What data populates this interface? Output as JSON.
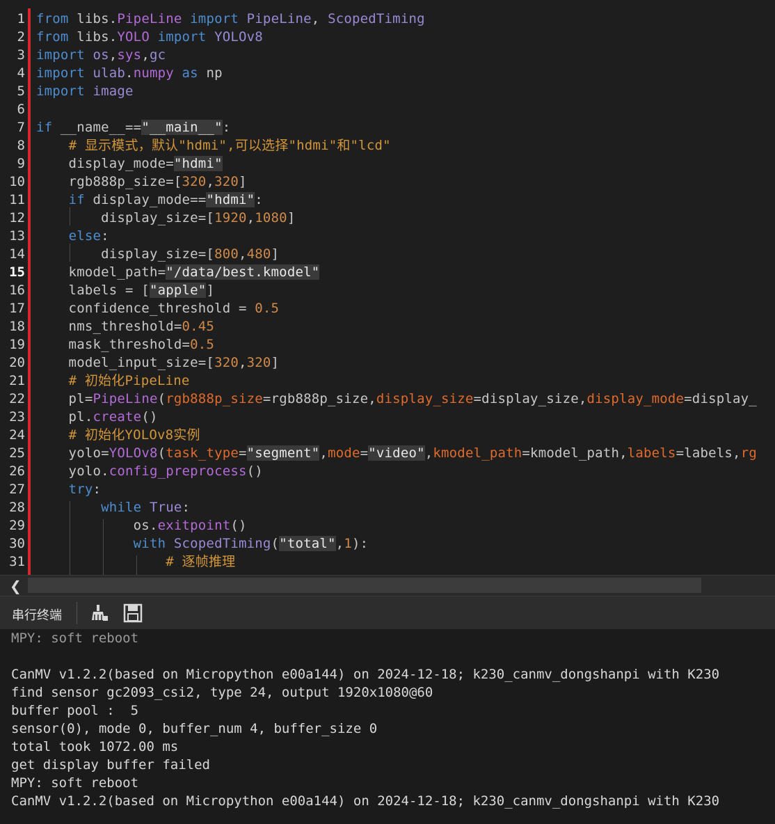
{
  "editor": {
    "current_line": 15,
    "lines": [
      {
        "n": "1",
        "tokens": [
          [
            "kw",
            "from "
          ],
          [
            "mod",
            "libs"
          ],
          [
            "plain",
            "."
          ],
          [
            "fn",
            "PipeLine"
          ],
          [
            "kw",
            " import "
          ],
          [
            "cls",
            "PipeLine"
          ],
          [
            "plain",
            ", "
          ],
          [
            "cls",
            "ScopedTiming"
          ]
        ]
      },
      {
        "n": "2",
        "tokens": [
          [
            "kw",
            "from "
          ],
          [
            "mod",
            "libs"
          ],
          [
            "plain",
            "."
          ],
          [
            "fn",
            "YOLO"
          ],
          [
            "kw",
            " import "
          ],
          [
            "cls",
            "YOLOv8"
          ]
        ]
      },
      {
        "n": "3",
        "tokens": [
          [
            "kw",
            "import "
          ],
          [
            "cls",
            "os"
          ],
          [
            "plain",
            ","
          ],
          [
            "fn",
            "sys"
          ],
          [
            "plain",
            ","
          ],
          [
            "cls",
            "gc"
          ]
        ]
      },
      {
        "n": "4",
        "tokens": [
          [
            "kw",
            "import "
          ],
          [
            "cls",
            "ulab"
          ],
          [
            "plain",
            "."
          ],
          [
            "fn",
            "numpy"
          ],
          [
            "kw",
            " as "
          ],
          [
            "plain",
            "np"
          ]
        ]
      },
      {
        "n": "5",
        "tokens": [
          [
            "kw",
            "import "
          ],
          [
            "cls",
            "image"
          ]
        ]
      },
      {
        "n": "6",
        "tokens": []
      },
      {
        "n": "7",
        "tokens": [
          [
            "kw",
            "if "
          ],
          [
            "plain",
            "__name__=="
          ],
          [
            "str",
            "\"__main__\""
          ],
          [
            "plain",
            ":"
          ]
        ]
      },
      {
        "n": "8",
        "tokens": [
          [
            "plain",
            "    "
          ],
          [
            "cmt",
            "# 显示模式，默认\"hdmi\",可以选择\"hdmi\"和\"lcd\""
          ]
        ]
      },
      {
        "n": "9",
        "tokens": [
          [
            "plain",
            "    display_mode="
          ],
          [
            "str",
            "\"hdmi\""
          ]
        ]
      },
      {
        "n": "10",
        "tokens": [
          [
            "plain",
            "    rgb888p_size=["
          ],
          [
            "num",
            "320"
          ],
          [
            "plain",
            ","
          ],
          [
            "num",
            "320"
          ],
          [
            "plain",
            "]"
          ]
        ]
      },
      {
        "n": "11",
        "tokens": [
          [
            "plain",
            "    "
          ],
          [
            "kw",
            "if "
          ],
          [
            "plain",
            "display_mode=="
          ],
          [
            "str",
            "\"hdmi\""
          ],
          [
            "plain",
            ":"
          ]
        ]
      },
      {
        "n": "12",
        "tokens": [
          [
            "plain",
            "        display_size=["
          ],
          [
            "num",
            "1920"
          ],
          [
            "plain",
            ","
          ],
          [
            "num",
            "1080"
          ],
          [
            "plain",
            "]"
          ]
        ]
      },
      {
        "n": "13",
        "tokens": [
          [
            "plain",
            "    "
          ],
          [
            "kw",
            "else"
          ],
          [
            "plain",
            ":"
          ]
        ]
      },
      {
        "n": "14",
        "tokens": [
          [
            "plain",
            "        display_size=["
          ],
          [
            "num",
            "800"
          ],
          [
            "plain",
            ","
          ],
          [
            "num",
            "480"
          ],
          [
            "plain",
            "]"
          ]
        ]
      },
      {
        "n": "15",
        "tokens": [
          [
            "plain",
            "    kmodel_path="
          ],
          [
            "str",
            "\"/data/best.kmodel\""
          ]
        ]
      },
      {
        "n": "16",
        "tokens": [
          [
            "plain",
            "    labels = ["
          ],
          [
            "str",
            "\"apple\""
          ],
          [
            "plain",
            "]"
          ]
        ]
      },
      {
        "n": "17",
        "tokens": [
          [
            "plain",
            "    confidence_threshold = "
          ],
          [
            "num",
            "0.5"
          ]
        ]
      },
      {
        "n": "18",
        "tokens": [
          [
            "plain",
            "    nms_threshold="
          ],
          [
            "num",
            "0.45"
          ]
        ]
      },
      {
        "n": "19",
        "tokens": [
          [
            "plain",
            "    mask_threshold="
          ],
          [
            "num",
            "0.5"
          ]
        ]
      },
      {
        "n": "20",
        "tokens": [
          [
            "plain",
            "    model_input_size=["
          ],
          [
            "num",
            "320"
          ],
          [
            "plain",
            ","
          ],
          [
            "num",
            "320"
          ],
          [
            "plain",
            "]"
          ]
        ]
      },
      {
        "n": "21",
        "tokens": [
          [
            "plain",
            "    "
          ],
          [
            "cmt",
            "# 初始化PipeLine"
          ]
        ]
      },
      {
        "n": "22",
        "tokens": [
          [
            "plain",
            "    pl="
          ],
          [
            "fn",
            "PipeLine"
          ],
          [
            "plain",
            "("
          ],
          [
            "param",
            "rgb888p_size"
          ],
          [
            "plain",
            "=rgb888p_size,"
          ],
          [
            "param",
            "display_size"
          ],
          [
            "plain",
            "=display_size,"
          ],
          [
            "param",
            "display_mode"
          ],
          [
            "plain",
            "=display_"
          ]
        ]
      },
      {
        "n": "23",
        "tokens": [
          [
            "plain",
            "    pl."
          ],
          [
            "fn",
            "create"
          ],
          [
            "plain",
            "()"
          ]
        ]
      },
      {
        "n": "24",
        "tokens": [
          [
            "plain",
            "    "
          ],
          [
            "cmt",
            "# 初始化YOLOv8实例"
          ]
        ]
      },
      {
        "n": "25",
        "tokens": [
          [
            "plain",
            "    yolo="
          ],
          [
            "fn",
            "YOLOv8"
          ],
          [
            "plain",
            "("
          ],
          [
            "param",
            "task_type"
          ],
          [
            "plain",
            "="
          ],
          [
            "str",
            "\"segment\""
          ],
          [
            "plain",
            ","
          ],
          [
            "param",
            "mode"
          ],
          [
            "plain",
            "="
          ],
          [
            "str",
            "\"video\""
          ],
          [
            "plain",
            ","
          ],
          [
            "param",
            "kmodel_path"
          ],
          [
            "plain",
            "=kmodel_path,"
          ],
          [
            "param",
            "labels"
          ],
          [
            "plain",
            "=labels,"
          ],
          [
            "param",
            "rg"
          ]
        ]
      },
      {
        "n": "26",
        "tokens": [
          [
            "plain",
            "    yolo."
          ],
          [
            "fn",
            "config_preprocess"
          ],
          [
            "plain",
            "()"
          ]
        ]
      },
      {
        "n": "27",
        "tokens": [
          [
            "plain",
            "    "
          ],
          [
            "kw",
            "try"
          ],
          [
            "plain",
            ":"
          ]
        ]
      },
      {
        "n": "28",
        "tokens": [
          [
            "plain",
            "        "
          ],
          [
            "kw",
            "while "
          ],
          [
            "cls",
            "True"
          ],
          [
            "plain",
            ":"
          ]
        ]
      },
      {
        "n": "29",
        "tokens": [
          [
            "plain",
            "            os."
          ],
          [
            "fn",
            "exitpoint"
          ],
          [
            "plain",
            "()"
          ]
        ]
      },
      {
        "n": "30",
        "tokens": [
          [
            "plain",
            "            "
          ],
          [
            "kw",
            "with "
          ],
          [
            "cls",
            "ScopedTiming"
          ],
          [
            "plain",
            "("
          ],
          [
            "str",
            "\"total\""
          ],
          [
            "plain",
            ","
          ],
          [
            "num",
            "1"
          ],
          [
            "plain",
            "):"
          ]
        ]
      },
      {
        "n": "31",
        "tokens": [
          [
            "plain",
            "                "
          ],
          [
            "cmt",
            "# 逐帧推理"
          ]
        ]
      }
    ]
  },
  "terminal": {
    "title": "串行终端",
    "icons": [
      "clear-broom-icon",
      "save-disk-icon"
    ],
    "lines": [
      "MPY: soft reboot",
      "",
      "CanMV v1.2.2(based on Micropython e00a144) on 2024-12-18; k230_canmv_dongshanpi with K230",
      "find sensor gc2093_csi2, type 24, output 1920x1080@60",
      "buffer pool :  5",
      "sensor(0), mode 0, buffer_num 4, buffer_size 0",
      "total took 1072.00 ms",
      "get display buffer failed",
      "MPY: soft reboot",
      "CanMV v1.2.2(based on Micropython e00a144) on 2024-12-18; k230_canmv_dongshanpi with K230"
    ]
  }
}
